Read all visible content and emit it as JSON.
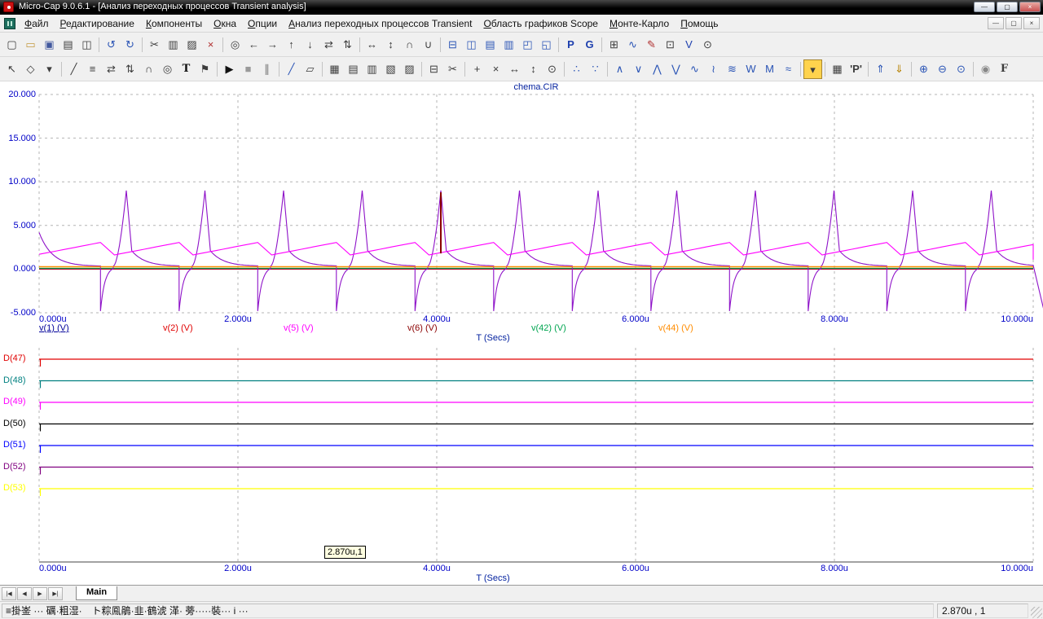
{
  "window": {
    "title": "Micro-Cap 9.0.6.1 - [Анализ переходных процессов Transient analysis]",
    "controls": {
      "minimize": "—",
      "restore": "▢",
      "close": "×"
    }
  },
  "menu": {
    "items": [
      "Файл",
      "Редактирование",
      "Компоненты",
      "Окна",
      "Опции",
      "Анализ переходных процессов Transient",
      "Область графиков Scope",
      "Монте-Карло",
      "Помощь"
    ],
    "child_controls": {
      "minimize": "—",
      "restore": "▢",
      "close": "×"
    }
  },
  "toolbars": {
    "row1": [
      {
        "name": "new-file-icon",
        "glyph": "▢"
      },
      {
        "name": "open-folder-icon",
        "glyph": "▭",
        "color": "#c49a3f"
      },
      {
        "name": "save-icon",
        "glyph": "▣",
        "color": "#41589e"
      },
      {
        "name": "print-icon",
        "glyph": "▤"
      },
      {
        "name": "print-preview-icon",
        "glyph": "◫"
      },
      {
        "sep": true
      },
      {
        "name": "undo-icon",
        "glyph": "↺",
        "color": "#2a54b5"
      },
      {
        "name": "redo-icon",
        "glyph": "↻",
        "color": "#2a54b5"
      },
      {
        "sep": true
      },
      {
        "name": "cut-icon",
        "glyph": "✂"
      },
      {
        "name": "copy-icon",
        "glyph": "▥"
      },
      {
        "name": "paste-icon",
        "glyph": "▨"
      },
      {
        "name": "delete-icon",
        "glyph": "×",
        "color": "#b03030"
      },
      {
        "sep": true
      },
      {
        "name": "find-icon",
        "glyph": "◎"
      },
      {
        "name": "step-back-icon",
        "glyph": "←"
      },
      {
        "name": "step-forward-icon",
        "glyph": "→"
      },
      {
        "name": "move-up-icon",
        "glyph": "↑"
      },
      {
        "name": "move-down-icon",
        "glyph": "↓"
      },
      {
        "name": "swap-horizontal-icon",
        "glyph": "⇄"
      },
      {
        "name": "swap-vertical-icon",
        "glyph": "⇅"
      },
      {
        "sep": true
      },
      {
        "name": "mirror-horizontal-icon",
        "glyph": "↔"
      },
      {
        "name": "mirror-vertical-icon",
        "glyph": "↕"
      },
      {
        "name": "rotate-icon",
        "glyph": "∩"
      },
      {
        "name": "flip-icon",
        "glyph": "∪"
      },
      {
        "sep": true
      },
      {
        "name": "split-horizontal-icon",
        "glyph": "⊟",
        "color": "#2a54b5"
      },
      {
        "name": "split-vertical-icon",
        "glyph": "◫",
        "color": "#2a54b5"
      },
      {
        "name": "tile-horizontal-icon",
        "glyph": "▤",
        "color": "#2a54b5"
      },
      {
        "name": "tile-vertical-icon",
        "glyph": "▥",
        "color": "#2a54b5"
      },
      {
        "name": "cascade-windows-icon",
        "glyph": "◰",
        "color": "#2a54b5"
      },
      {
        "name": "overlap-windows-icon",
        "glyph": "◱",
        "color": "#2a54b5"
      },
      {
        "sep": true
      },
      {
        "name": "letter-p-button",
        "glyph": "P",
        "color": "#1d3fae",
        "bold": true
      },
      {
        "name": "letter-g-button",
        "glyph": "G",
        "color": "#1d3fae",
        "bold": true
      },
      {
        "sep": true
      },
      {
        "name": "grid-icon",
        "glyph": "⊞"
      },
      {
        "name": "waveform-probe-icon",
        "glyph": "∿",
        "color": "#2a54b5"
      },
      {
        "name": "pencil-icon",
        "glyph": "✎",
        "color": "#b03030"
      },
      {
        "name": "numeric-output-icon",
        "glyph": "⊡"
      },
      {
        "name": "node-voltage-icon",
        "glyph": "V",
        "color": "#1d3fae"
      },
      {
        "name": "animate-icon",
        "glyph": "⊙"
      }
    ],
    "row2": [
      {
        "name": "select-mode-icon",
        "glyph": "↖"
      },
      {
        "name": "component-mode-icon",
        "glyph": "◇"
      },
      {
        "name": "mode-dropdown-icon",
        "glyph": "▾"
      },
      {
        "sep": true
      },
      {
        "name": "wire-mode-icon",
        "glyph": "╱"
      },
      {
        "name": "bus-mode-icon",
        "glyph": "≡"
      },
      {
        "name": "flip-x-icon",
        "glyph": "⇄"
      },
      {
        "name": "flip-y-icon",
        "glyph": "⇅"
      },
      {
        "name": "rotate-mode-icon",
        "glyph": "∩"
      },
      {
        "name": "find-component-icon",
        "glyph": "◎"
      },
      {
        "name": "text-mode-icon",
        "glyph": "T",
        "bold": true,
        "serif": true,
        "color": "#111111"
      },
      {
        "name": "flag-icon",
        "glyph": "⚑"
      },
      {
        "sep": true
      },
      {
        "name": "run-button",
        "glyph": "▶",
        "color": "#111111"
      },
      {
        "name": "stop-button",
        "glyph": "■",
        "color": "#9a9a9a"
      },
      {
        "name": "pause-button",
        "glyph": "∥",
        "color": "#9a9a9a",
        "bold": true
      },
      {
        "sep": true
      },
      {
        "name": "line-tool-icon",
        "glyph": "╱",
        "color": "#2a54b5"
      },
      {
        "name": "polygon-tool-icon",
        "glyph": "▱"
      },
      {
        "sep": true
      },
      {
        "name": "grid-pattern-icon",
        "glyph": "▦"
      },
      {
        "name": "data-points-icon",
        "glyph": "▤"
      },
      {
        "name": "ruler-icon",
        "glyph": "▥"
      },
      {
        "name": "hatch-icon",
        "glyph": "▧"
      },
      {
        "name": "token-icon",
        "glyph": "▨"
      },
      {
        "sep": true
      },
      {
        "name": "horizontal-axis-icon",
        "glyph": "⊟"
      },
      {
        "name": "scissors-icon",
        "glyph": "✂"
      },
      {
        "sep": true
      },
      {
        "name": "cursor-mode-icon",
        "glyph": "+"
      },
      {
        "name": "tag-x-icon",
        "glyph": "×"
      },
      {
        "name": "tag-horizontal-icon",
        "glyph": "↔"
      },
      {
        "name": "tag-vertical-icon",
        "glyph": "↕"
      },
      {
        "name": "tag-point-icon",
        "glyph": "⊙"
      },
      {
        "sep": true
      },
      {
        "name": "align-cursors-icon",
        "glyph": "∴",
        "color": "#2a54b5"
      },
      {
        "name": "pan-mode-icon",
        "glyph": "∵",
        "color": "#2a54b5"
      },
      {
        "sep": true
      },
      {
        "name": "go-to-peak-icon",
        "glyph": "∧",
        "color": "#2a54b5"
      },
      {
        "name": "go-to-valley-icon",
        "glyph": "∨",
        "color": "#2a54b5"
      },
      {
        "name": "rise-edge-icon",
        "glyph": "⋀",
        "color": "#2a54b5"
      },
      {
        "name": "fall-edge-icon",
        "glyph": "⋁",
        "color": "#2a54b5"
      },
      {
        "name": "waveform-icon",
        "glyph": "∿",
        "color": "#2a54b5"
      },
      {
        "name": "period-icon",
        "glyph": "≀",
        "color": "#2a54b5"
      },
      {
        "name": "frequency-icon",
        "glyph": "≋",
        "color": "#2a54b5"
      },
      {
        "name": "high-low-icon",
        "glyph": "W",
        "color": "#2a54b5"
      },
      {
        "name": "envelope-icon",
        "glyph": "M",
        "color": "#2a54b5"
      },
      {
        "name": "smooth-icon",
        "glyph": "≈",
        "color": "#2a54b5"
      },
      {
        "sep": true
      },
      {
        "name": "waveform-buffer-dropdown",
        "glyph": "▾",
        "bg": "#ffd34d"
      },
      {
        "sep": true
      },
      {
        "name": "numeric-output-table-icon",
        "glyph": "▦"
      },
      {
        "name": "quoted-p-button",
        "glyph": "'P'",
        "bold": true
      },
      {
        "sep": true
      },
      {
        "name": "scope-previous-icon",
        "glyph": "⇑",
        "color": "#2a54b5"
      },
      {
        "name": "scope-next-icon",
        "glyph": "⇓",
        "color": "#b8860b"
      },
      {
        "sep": true
      },
      {
        "name": "zoom-in-icon",
        "glyph": "⊕",
        "color": "#2a54b5"
      },
      {
        "name": "zoom-out-icon",
        "glyph": "⊖",
        "color": "#2a54b5"
      },
      {
        "name": "zoom-window-icon",
        "glyph": "⊙",
        "color": "#2a54b5"
      },
      {
        "sep": true
      },
      {
        "name": "mode-circle-icon",
        "glyph": "◉",
        "color": "#888888"
      },
      {
        "name": "f-key-button",
        "glyph": "F",
        "bold": true,
        "serif": true
      }
    ]
  },
  "analog_plot": {
    "title": "chema.CIR",
    "y_ticks": [
      "20.000",
      "15.000",
      "10.000",
      "5.000",
      "0.000",
      "-5.000"
    ],
    "x_ticks": [
      "0.000u",
      "2.000u",
      "4.000u",
      "6.000u",
      "8.000u",
      "10.000u"
    ],
    "x_label": "T (Secs)",
    "ylim": [
      -5,
      20
    ],
    "xlim_us": [
      0,
      10
    ],
    "legend": [
      {
        "label": "v(1) (V)",
        "color": "#000099",
        "underline": true
      },
      {
        "label": "v(2) (V)",
        "color": "#e00000"
      },
      {
        "label": "v(5) (V)",
        "color": "#ff00ff"
      },
      {
        "label": "v(6) (V)",
        "color": "#8b0000"
      },
      {
        "label": "v(42) (V)",
        "color": "#00a550"
      },
      {
        "label": "v(44) (V)",
        "color": "#ff8c00"
      }
    ]
  },
  "digital_plot": {
    "x_ticks": [
      "0.000u",
      "2.000u",
      "4.000u",
      "6.000u",
      "8.000u",
      "10.000u"
    ],
    "x_label": "T (Secs)",
    "cursor_label": "2.870u,1",
    "traces": [
      {
        "label": "D(47)",
        "color": "#e00000",
        "value": 1
      },
      {
        "label": "D(48)",
        "color": "#008080",
        "value": 1
      },
      {
        "label": "D(49)",
        "color": "#ff00ff",
        "value": 1
      },
      {
        "label": "D(50)",
        "color": "#000000",
        "value": 1
      },
      {
        "label": "D(51)",
        "color": "#0000ff",
        "value": 1
      },
      {
        "label": "D(52)",
        "color": "#800080",
        "value": 1
      },
      {
        "label": "D(53)",
        "color": "#ffff00",
        "value": 1
      }
    ]
  },
  "waveforms": {
    "analog": {
      "spike": {
        "name": "relaxation-spike-trace",
        "color": "#8e12c8",
        "first_peak": 0.877,
        "period": 0.791,
        "lead": 0.26,
        "peak": 9.0,
        "drop": -4.8,
        "base": 0.33,
        "start": 4.2,
        "tau": 0.13,
        "rec": 0.13,
        "fall": 0.055,
        "after": 2.1
      },
      "saw": {
        "name": "ramp-trace",
        "color": "#ff00ff",
        "base": 1.62,
        "top": 3.05,
        "fall": 0.14
      },
      "flat": [
        {
          "name": "v1-flat",
          "color": "#000099",
          "v": 0.0
        },
        {
          "name": "v2-flat",
          "color": "#e00000",
          "v": 0.02
        },
        {
          "name": "v42-flat",
          "color": "#00a550",
          "v": 0.09
        },
        {
          "name": "v44-flat",
          "color": "#ff8c00",
          "v": 0.27,
          "top": true
        }
      ],
      "pulse": {
        "name": "v6-pulse",
        "color": "#8b0000",
        "t": 4.041,
        "v_top": 8.8,
        "v_bottom": 1.8
      }
    }
  },
  "tab_bar": {
    "nav": [
      "|◀",
      "◀",
      "▶",
      "▶|"
    ],
    "tabs": [
      {
        "label": "Main",
        "active": true
      }
    ]
  },
  "status_bar": {
    "left": "≡掛崟 ··· 礪·粗湿·　ト粽鳯鵑·韭·鶴淲 㴖· 蒡·····裝··· i ···",
    "right": "2.870u , 1"
  }
}
